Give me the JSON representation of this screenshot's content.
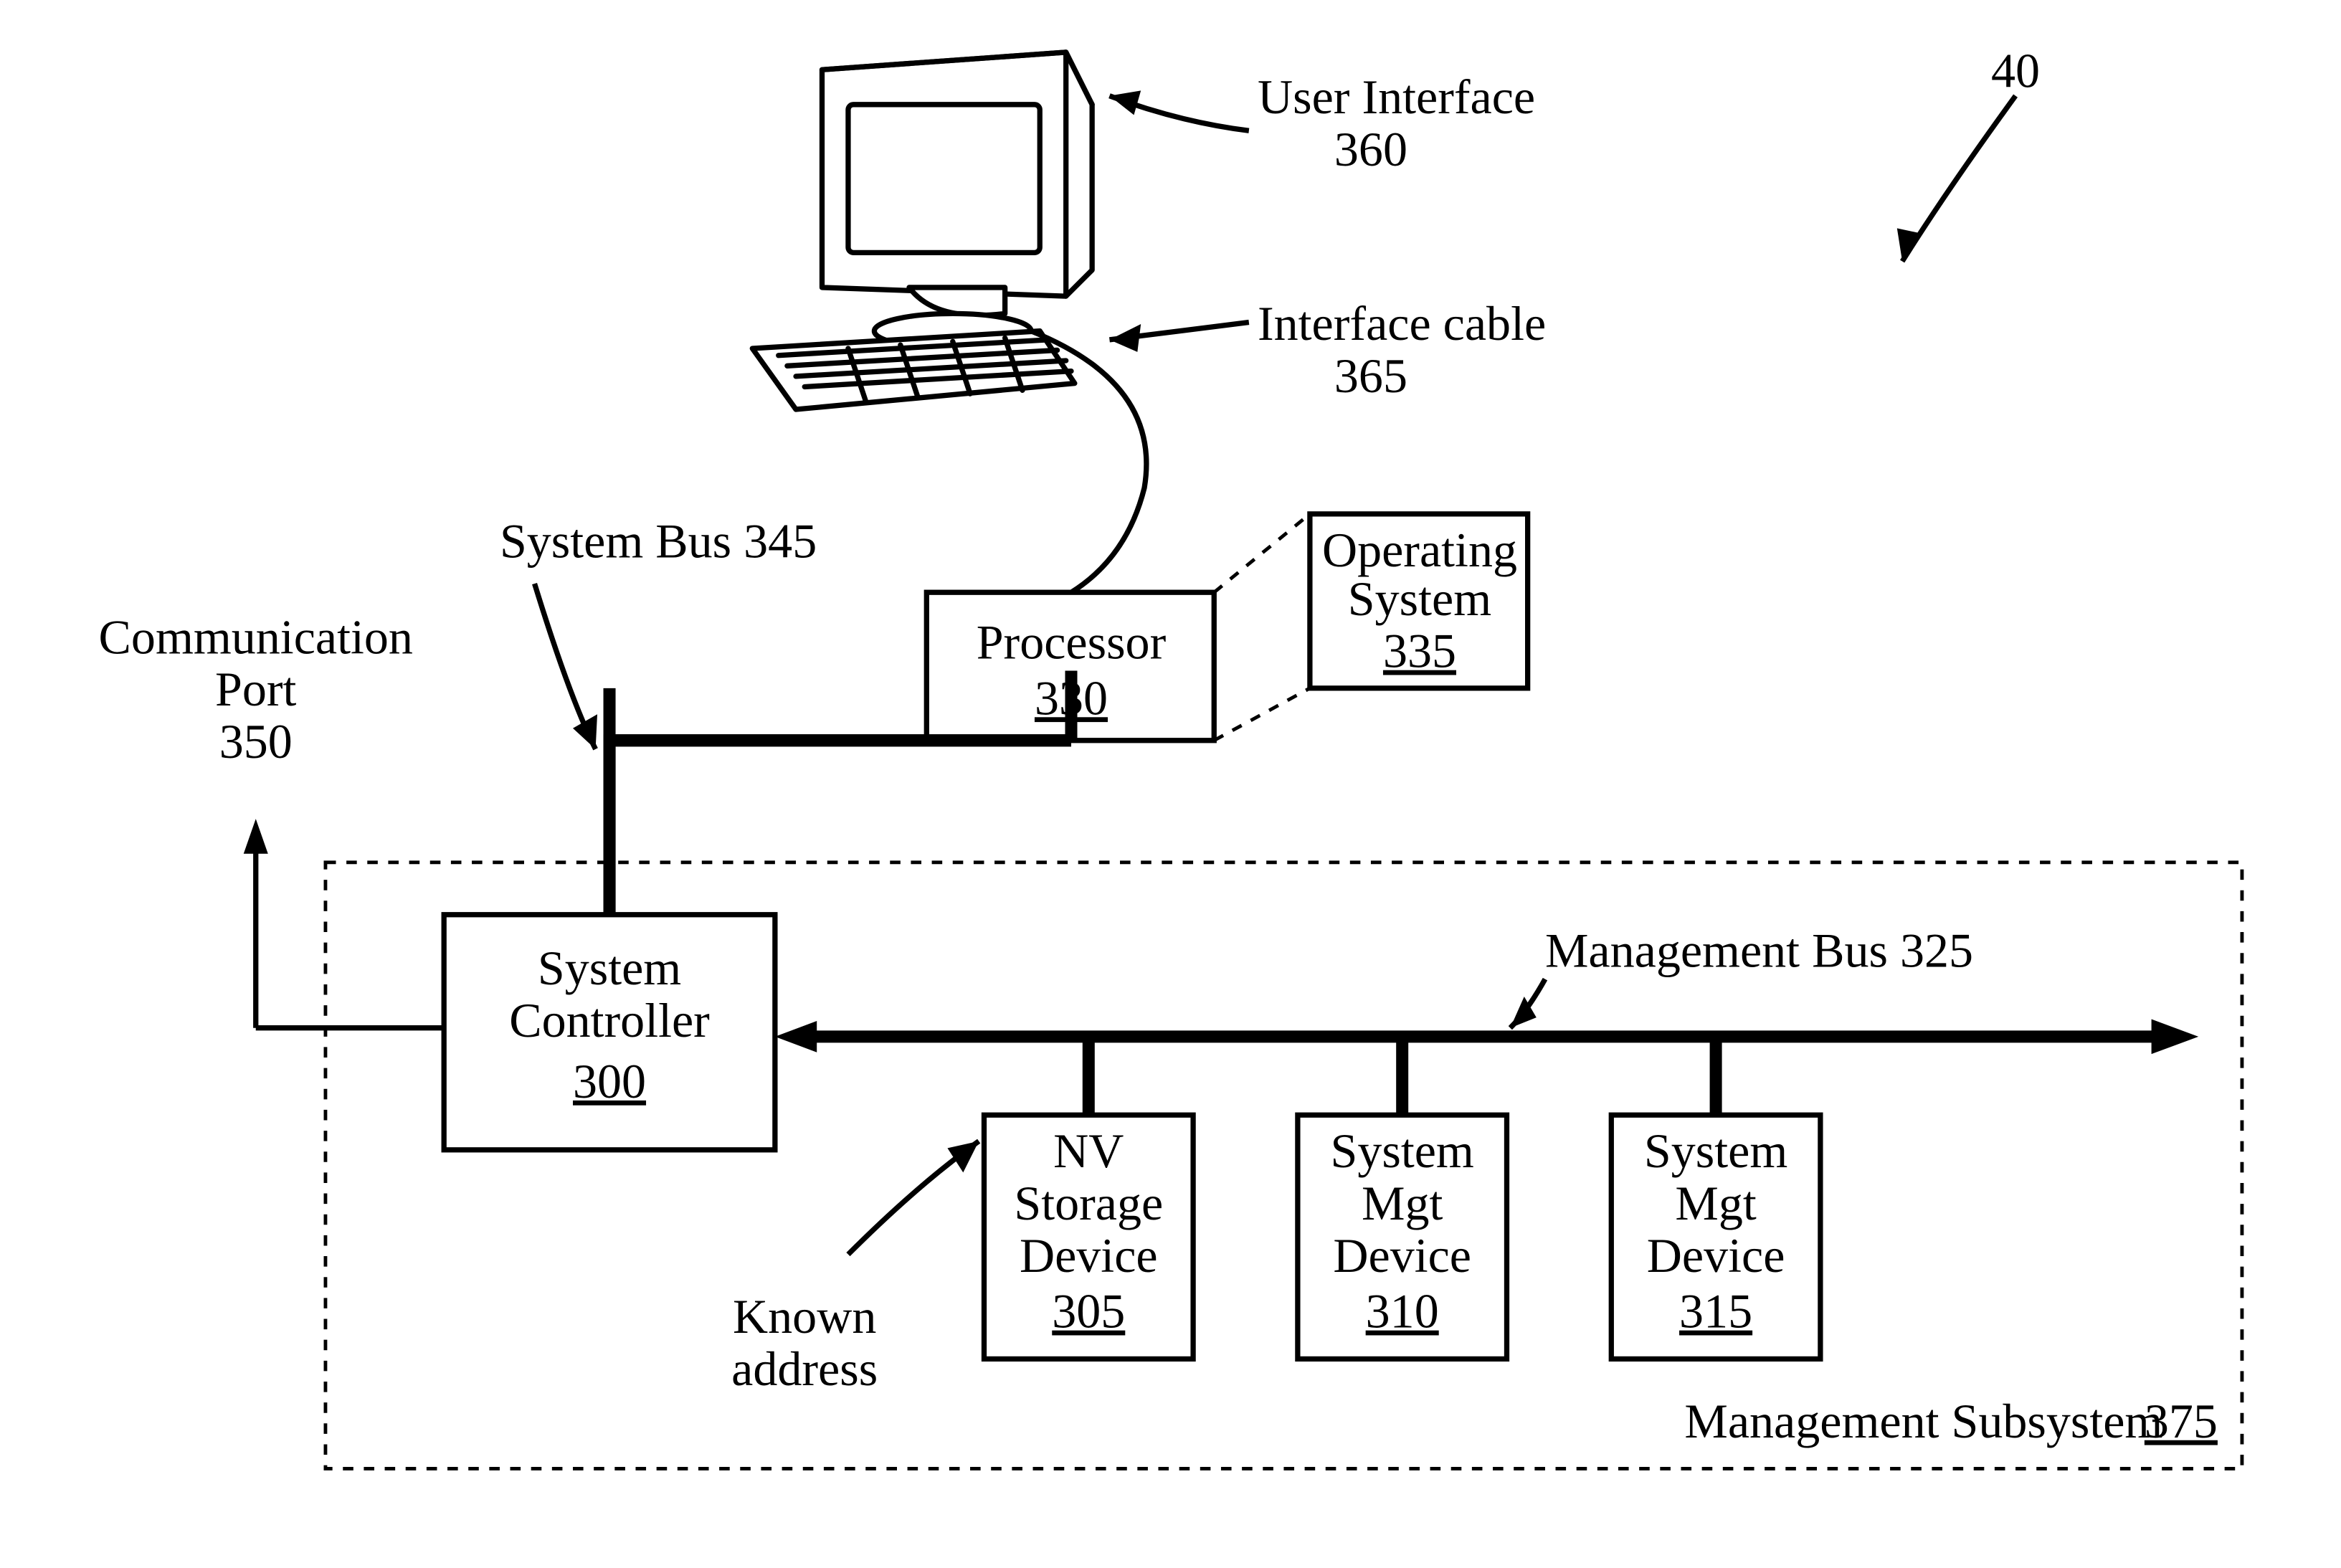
{
  "figure_ref": "40",
  "labels": {
    "ui": {
      "name": "User Interface",
      "num": "360"
    },
    "cable": {
      "name": "Interface cable",
      "num": "365"
    },
    "sysbus": {
      "name": "System Bus 345"
    },
    "commport": {
      "l1": "Communication",
      "l2": "Port",
      "num": "350"
    },
    "mgmtbus": {
      "name": "Management Bus 325"
    },
    "known": {
      "l1": "Known",
      "l2": "address"
    },
    "subsys": {
      "name": "Management Subsystem",
      "num": "375"
    }
  },
  "boxes": {
    "processor": {
      "name": "Processor",
      "num": "330"
    },
    "os": {
      "l1": "Operating",
      "l2": "System",
      "num": "335"
    },
    "controller": {
      "l1": "System",
      "l2": "Controller",
      "num": "300"
    },
    "nv": {
      "l1": "NV",
      "l2": "Storage",
      "l3": "Device",
      "num": "305"
    },
    "smd1": {
      "l1": "System",
      "l2": "Mgt",
      "l3": "Device",
      "num": "310"
    },
    "smd2": {
      "l1": "System",
      "l2": "Mgt",
      "l3": "Device",
      "num": "315"
    }
  }
}
